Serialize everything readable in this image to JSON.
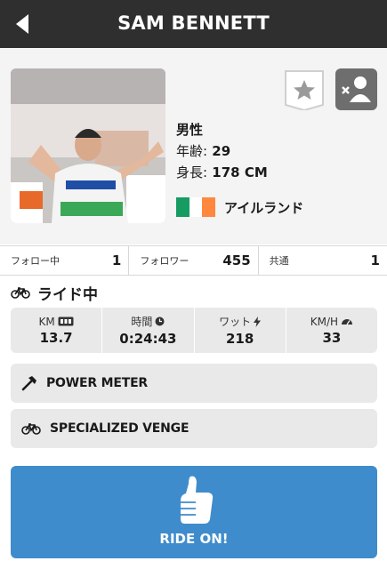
{
  "header": {
    "title": "SAM BENNETT",
    "back_icon": "back-arrow-icon"
  },
  "profile": {
    "gender": "男性",
    "age_label": "年齢:",
    "age": "29",
    "height_label": "身長:",
    "height": "178 CM",
    "country": "アイルランド",
    "flag_colors": [
      "#169b62",
      "#ffffff",
      "#ff883e"
    ]
  },
  "stats": [
    {
      "label": "フォロー中",
      "value": "1"
    },
    {
      "label": "フォロワー",
      "value": "455"
    },
    {
      "label": "共通",
      "value": "1"
    }
  ],
  "riding": {
    "title": "ライド中"
  },
  "metrics": [
    {
      "label": "KM",
      "icon": "odometer-icon",
      "value": "13.7"
    },
    {
      "label": "時間",
      "icon": "clock-icon",
      "value": "0:24:43"
    },
    {
      "label": "ワット",
      "icon": "lightning-icon",
      "value": "218"
    },
    {
      "label": "KM/H",
      "icon": "speedometer-icon",
      "value": "33"
    }
  ],
  "equipment": [
    {
      "label": "POWER METER",
      "icon": "hammer-icon"
    },
    {
      "label": "SPECIALIZED VENGE",
      "icon": "bike-icon"
    }
  ],
  "ride_on": {
    "label": "RIDE ON!"
  },
  "colors": {
    "header_bg": "#2f2f2f",
    "ride_on_bg": "#3f8ccc",
    "card_bg": "#e9e9e9"
  }
}
